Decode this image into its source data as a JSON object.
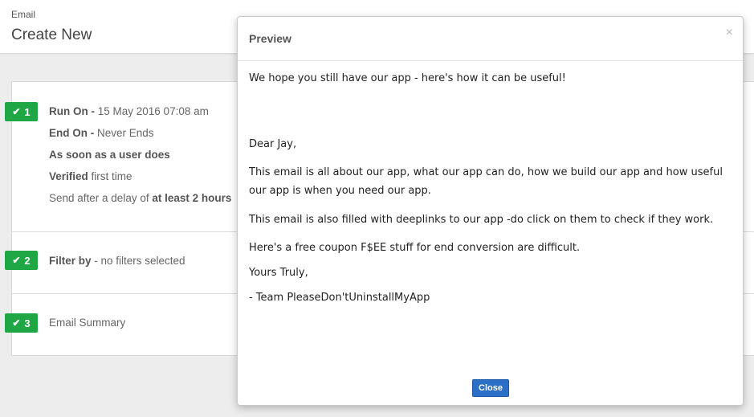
{
  "header": {
    "breadcrumb": "Email",
    "title": "Create New"
  },
  "steps": [
    {
      "number": "1",
      "lines": [
        {
          "bold": "Run On -",
          "text": " 15 May 2016 07:08 am"
        },
        {
          "bold": "End On -",
          "text": " Never Ends"
        },
        {
          "bold": "As soon as a user does",
          "text": ""
        },
        {
          "bold": "Verified",
          "text": " first time"
        },
        {
          "pre": "Send after a delay of ",
          "bold": "at least 2 hours"
        }
      ]
    },
    {
      "number": "2",
      "lines": [
        {
          "bold": "Filter by",
          "text": " - no filters selected"
        }
      ]
    },
    {
      "number": "3",
      "lines": [
        {
          "pre": "Email Summary"
        }
      ]
    }
  ],
  "modal": {
    "title": "Preview",
    "close_x": "×",
    "subject": "We hope you still have our app - here's how it can be useful!",
    "greeting": "Dear Jay,",
    "para1": "This email is all about our app, what our app can do, how we build our app and how useful our app is when you need our app.",
    "para2": "This email is also filled with deeplinks to our app -do click on them to check if they work.",
    "para3": "Here's a free coupon F$EE stuff for end conversion are difficult.",
    "signoff": "Yours Truly,",
    "signature": "- Team PleaseDon'tUninstallMyApp",
    "close_label": "Close"
  },
  "colors": {
    "badge": "#1fa745",
    "button": "#2b6fc7"
  }
}
